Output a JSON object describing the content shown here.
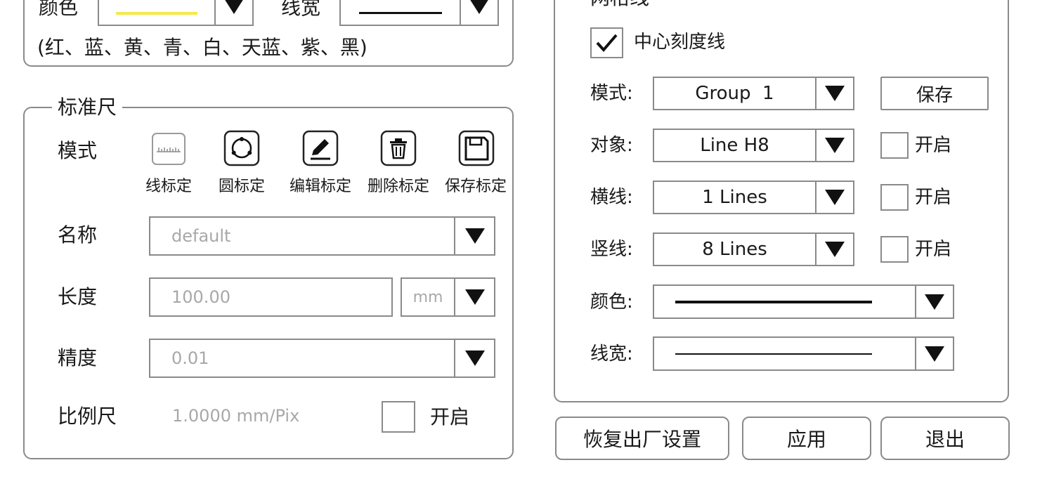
{
  "top_left": {
    "color_label": "颜色",
    "width_label": "线宽",
    "color_hint": "(红、蓝、黄、青、白、天蓝、紫、黑)",
    "line_color": "#f5e94a"
  },
  "ruler": {
    "legend": "标准尺",
    "mode_label": "模式",
    "tools": [
      {
        "label": "线标定",
        "icon": "ruler-icon"
      },
      {
        "label": "圆标定",
        "icon": "circle-target-icon"
      },
      {
        "label": "编辑标定",
        "icon": "edit-pencil-icon"
      },
      {
        "label": "删除标定",
        "icon": "trash-icon"
      },
      {
        "label": "保存标定",
        "icon": "save-disk-icon"
      }
    ],
    "name_label": "名称",
    "name_value": "default",
    "length_label": "长度",
    "length_value": "100.00",
    "length_unit": "mm",
    "precision_label": "精度",
    "precision_value": "0.01",
    "scale_label": "比例尺",
    "scale_value": "1.0000 mm/Pix",
    "scale_enable_label": "开启",
    "scale_enabled": false
  },
  "grid": {
    "legend_partial": "网格线",
    "center_tick_label": "中心刻度线",
    "center_tick_checked": true,
    "mode_label": "模式:",
    "mode_value": "Group  1",
    "save_label": "保存",
    "object_label": "对象:",
    "object_value": "Line H8",
    "object_enable_label": "开启",
    "horizontal_label": "横线:",
    "horizontal_value": "1 Lines",
    "horizontal_enable_label": "开启",
    "vertical_label": "竖线:",
    "vertical_value": "8 Lines",
    "vertical_enable_label": "开启",
    "color_label": "颜色:",
    "width_label": "线宽:"
  },
  "footer": {
    "reset_label": "恢复出厂设置",
    "apply_label": "应用",
    "exit_label": "退出"
  }
}
